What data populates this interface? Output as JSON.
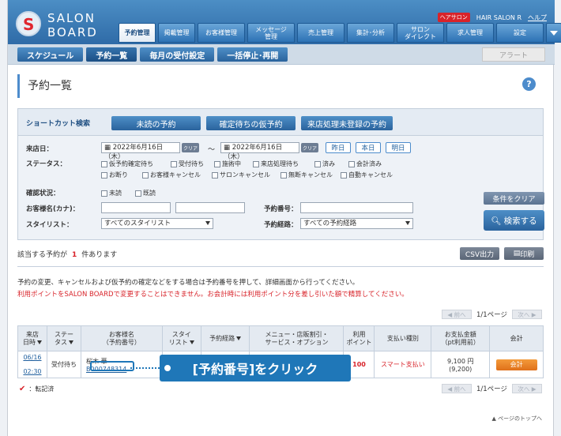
{
  "brand": {
    "line1": "SALON",
    "line2": "BOARD",
    "logo_letter": "S"
  },
  "header": {
    "salon_badge": "ヘアサロン",
    "salon_name": "HAIR SALON R",
    "help": "ヘルプ"
  },
  "main_nav": [
    {
      "label": "予約管理",
      "active": true
    },
    {
      "label": "掲載管理"
    },
    {
      "label": "お客様管理"
    },
    {
      "label": "メッセージ\n管理"
    },
    {
      "label": "売上管理"
    },
    {
      "label": "集計･分析"
    },
    {
      "label": "サロン\nダイレクト"
    },
    {
      "label": "求人管理"
    },
    {
      "label": "設定"
    }
  ],
  "sub_nav": [
    "スケジュール",
    "予約一覧",
    "毎月の受付設定",
    "一括停止･再開"
  ],
  "alert": "アラート",
  "page_title": "予約一覧",
  "help_icon": "?",
  "shortcut": {
    "label": "ショートカット検索",
    "buttons": [
      "未読の予約",
      "確定待ちの仮予約",
      "来店処理未登録の予約"
    ]
  },
  "form": {
    "visit_date_label": "来店日：",
    "date_from": "2022年6月16日（木）",
    "date_to": "2022年6月16日（木）",
    "date_sep": "～",
    "clear": "クリア",
    "day_buttons": [
      "昨日",
      "本日",
      "明日"
    ],
    "status_label": "ステータス：",
    "status_options_row1": [
      "仮予約確定待ち",
      "受付待ち",
      "施術中",
      "来店処理待ち",
      "済み",
      "会計済み"
    ],
    "status_options_row2": [
      "お断り",
      "お客様キャンセル",
      "サロンキャンセル",
      "無断キャンセル",
      "自動キャンセル"
    ],
    "confirm_label": "確認状況：",
    "confirm_options": [
      "未読",
      "既読"
    ],
    "customer_label": "お客様名(カナ)：",
    "resno_label": "予約番号：",
    "stylist_label": "スタイリスト：",
    "stylist_value": "すべてのスタイリスト",
    "route_label": "予約経路：",
    "route_value": "すべての予約経路",
    "clear_conditions": "条件をクリア",
    "search": "検索する"
  },
  "results": {
    "prefix": "該当する予約が",
    "count": "1",
    "suffix": "件あります",
    "csv": "CSV出力",
    "print": "印刷"
  },
  "notes": {
    "line1": "予約の変更、キャンセルおよび仮予約の確定などをする場合は予約番号を押して、詳細画面から行ってください。",
    "line2": "利用ポイントをSALON BOARDで変更することはできません。お会計時には利用ポイント分を差し引いた額で精算してください。"
  },
  "pager": {
    "prev": "前へ",
    "next": "次へ",
    "page": "1/1ページ"
  },
  "table": {
    "headers": {
      "visit": "来店\n日時",
      "status": "ステー\nタス",
      "customer": "お客様名\n（予約番号）",
      "stylist": "スタイ\nリスト",
      "route": "予約経路",
      "menu": "メニュー・店販割引・\nサービス・オプション",
      "points": "利用\nポイント",
      "payment": "支払い種別",
      "amount": "お支払金額\n（pt利用前）",
      "checkout": "会計"
    },
    "row": {
      "date": "06/16",
      "time": "02:30",
      "status": "受付待ち",
      "customer": "桜木 華",
      "resno": "B000748314",
      "points": "100",
      "payment": "スマート支払い",
      "amount": "9,100 円",
      "amount_before": "(9,200)",
      "checkout": "会計"
    }
  },
  "callout": "[予約番号]をクリック",
  "legend": {
    "mark": "✔",
    "text": "：転記済"
  },
  "to_top": "▲ ページのトップへ",
  "colors": {
    "primary": "#2f6ba7",
    "accent_red": "#d8232a",
    "callout": "#1f77b8",
    "checkout": "#e0701a"
  }
}
